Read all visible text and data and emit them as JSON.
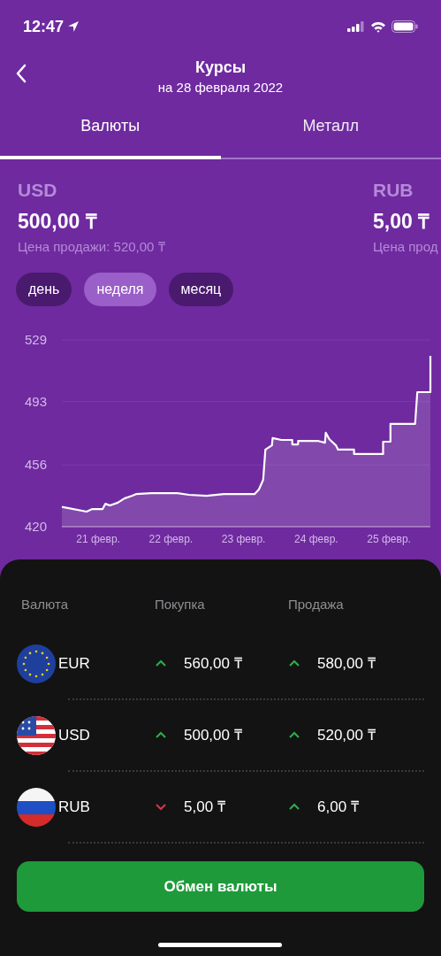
{
  "status_bar": {
    "time": "12:47"
  },
  "header": {
    "title": "Курсы",
    "subtitle": "на 28 февраля 2022"
  },
  "tabs": [
    {
      "label": "Валюты",
      "selected": true
    },
    {
      "label": "Металл",
      "selected": false
    }
  ],
  "rate_cards": [
    {
      "code": "USD",
      "value": "500,00 ₸",
      "sell_price": "Цена продажи: 520,00  ₸"
    },
    {
      "code": "RUB",
      "value": "5,00 ₸",
      "sell_price": "Цена прод"
    }
  ],
  "periods": [
    {
      "label": "день",
      "selected": false
    },
    {
      "label": "неделя",
      "selected": true
    },
    {
      "label": "месяц",
      "selected": false
    }
  ],
  "chart_data": {
    "type": "area",
    "xlim": [
      20.5,
      25.57
    ],
    "ylim": [
      420,
      529
    ],
    "yticks": [
      420,
      456,
      493,
      529
    ],
    "xticks": [
      {
        "value": 21,
        "label": "21 февр."
      },
      {
        "value": 22,
        "label": "22 февр."
      },
      {
        "value": 23,
        "label": "23 февр."
      },
      {
        "value": 24,
        "label": "24 февр."
      },
      {
        "value": 25,
        "label": "25 февр."
      }
    ],
    "x": [
      20.5,
      20.84,
      20.92,
      21.06,
      21.1,
      21.16,
      21.27,
      21.36,
      21.46,
      21.52,
      21.73,
      22.09,
      22.25,
      22.49,
      22.73,
      23.15,
      23.21,
      23.27,
      23.3,
      23.39,
      23.4,
      23.52,
      23.67,
      23.67,
      23.75,
      23.75,
      24.03,
      24.12,
      24.13,
      24.18,
      24.27,
      24.3,
      24.52,
      24.52,
      24.92,
      24.92,
      25.02,
      25.02,
      25.36,
      25.39,
      25.57,
      25.57
    ],
    "series": [
      {
        "color": "#ffffff",
        "values": [
          431.5,
          428.8,
          430.3,
          430.3,
          433.4,
          432.4,
          434,
          436.5,
          438,
          439,
          439.6,
          439.6,
          438.6,
          438,
          439,
          439,
          441.7,
          447.4,
          465,
          467.5,
          471.7,
          470.6,
          470.6,
          468,
          468,
          470,
          470,
          469,
          474.8,
          471,
          467.5,
          465,
          465,
          462.4,
          462.4,
          469.6,
          469.6,
          480,
          480,
          498.5,
          498.5,
          519.7
        ]
      }
    ]
  },
  "table": {
    "columns": [
      "Валюта",
      "Покупка",
      "Продажа"
    ],
    "rows": [
      {
        "kind": "eu",
        "code": "EUR",
        "buy": {
          "kind": "up",
          "value": "560,00 ₸"
        },
        "sell": {
          "kind": "up",
          "value": "580,00 ₸"
        }
      },
      {
        "kind": "us",
        "code": "USD",
        "buy": {
          "kind": "up",
          "value": "500,00 ₸"
        },
        "sell": {
          "kind": "up",
          "value": "520,00 ₸"
        }
      },
      {
        "kind": "ru",
        "code": "RUB",
        "buy": {
          "kind": "down",
          "value": "5,00 ₸"
        },
        "sell": {
          "kind": "up",
          "value": "6,00 ₸"
        }
      }
    ]
  },
  "exchange_button": "Обмен валюты"
}
